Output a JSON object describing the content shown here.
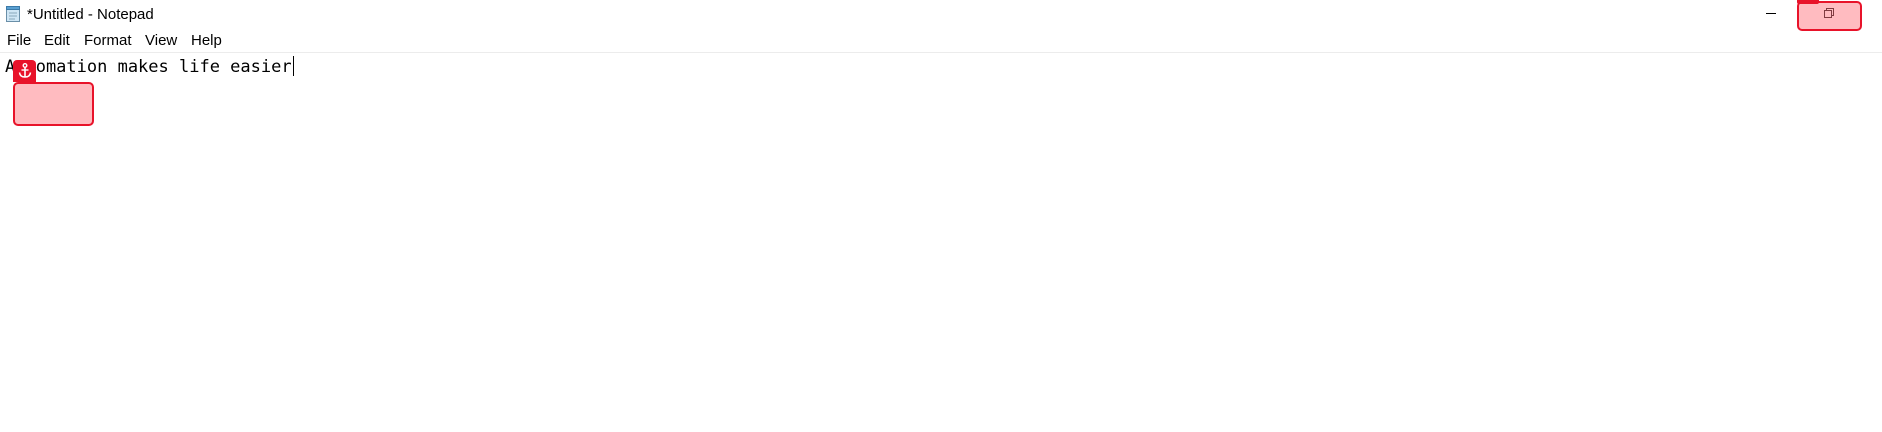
{
  "window": {
    "title": "*Untitled - Notepad",
    "app_icon": "notepad-icon",
    "controls": {
      "minimize_icon": "minimize-icon",
      "restore_icon": "restore-icon"
    }
  },
  "menu": {
    "items": [
      {
        "label": "File"
      },
      {
        "label": "Edit"
      },
      {
        "label": "Format"
      },
      {
        "label": "View"
      },
      {
        "label": "Help"
      }
    ]
  },
  "editor": {
    "content": "Automation makes life easier"
  },
  "annotations": {
    "anchor_marker_icon": "anchor-icon",
    "highlight_color": "#e8132a"
  }
}
